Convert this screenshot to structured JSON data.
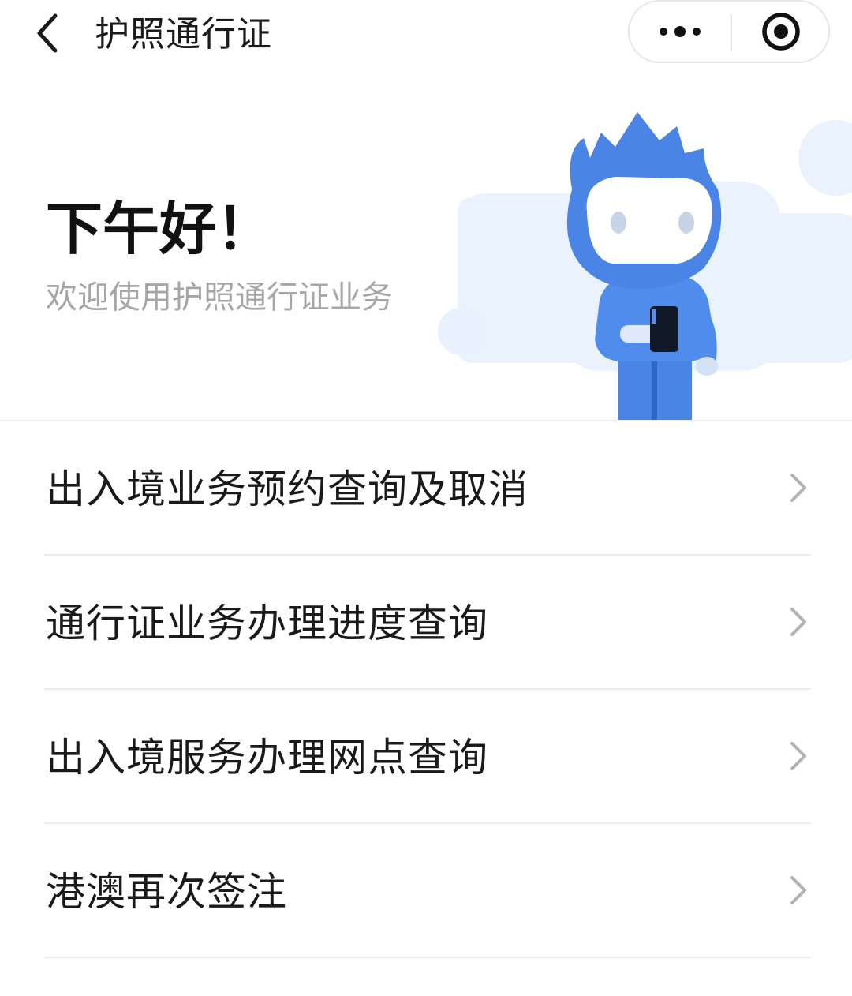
{
  "navbar": {
    "title": "护照通行证",
    "back_icon": "chevron-left-icon",
    "more_icon": "more-dots-icon",
    "close_icon": "target-circle-icon"
  },
  "hero": {
    "greeting": "下午好！",
    "subtitle": "欢迎使用护照通行证业务",
    "mascot": "blue-mascot-holding-phone",
    "accent_color": "#4a8ae8",
    "cloud_color": "#eaf2fd"
  },
  "menu": {
    "items": [
      {
        "label": "出入境业务预约查询及取消",
        "icon": "chevron-right-icon"
      },
      {
        "label": "通行证业务办理进度查询",
        "icon": "chevron-right-icon"
      },
      {
        "label": "出入境服务办理网点查询",
        "icon": "chevron-right-icon"
      },
      {
        "label": "港澳再次签注",
        "icon": "chevron-right-icon"
      }
    ]
  }
}
